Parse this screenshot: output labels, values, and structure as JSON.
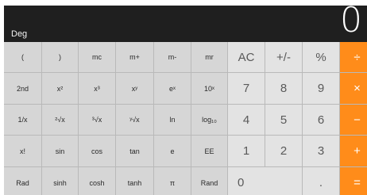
{
  "display": {
    "mode": "Deg",
    "value": "0"
  },
  "keys": [
    [
      "(",
      ")",
      "mc",
      "m+",
      "m-",
      "mr",
      "AC",
      "+/-",
      "%",
      "÷"
    ],
    [
      "2nd",
      "x²",
      "x³",
      "xʸ",
      "eˣ",
      "10ˣ",
      "7",
      "8",
      "9",
      "×"
    ],
    [
      "1/x",
      "²√x",
      "³√x",
      "ʸ√x",
      "ln",
      "log₁₀",
      "4",
      "5",
      "6",
      "−"
    ],
    [
      "x!",
      "sin",
      "cos",
      "tan",
      "e",
      "EE",
      "1",
      "2",
      "3",
      "+"
    ],
    [
      "Rad",
      "sinh",
      "cosh",
      "tanh",
      "π",
      "Rand",
      "0",
      ".",
      "="
    ]
  ],
  "colors": {
    "display_bg": "#1f1f1f",
    "operator": "#ff8c1a",
    "function_key": "#d6d6d6",
    "digit_key": "#e3e3e3"
  }
}
